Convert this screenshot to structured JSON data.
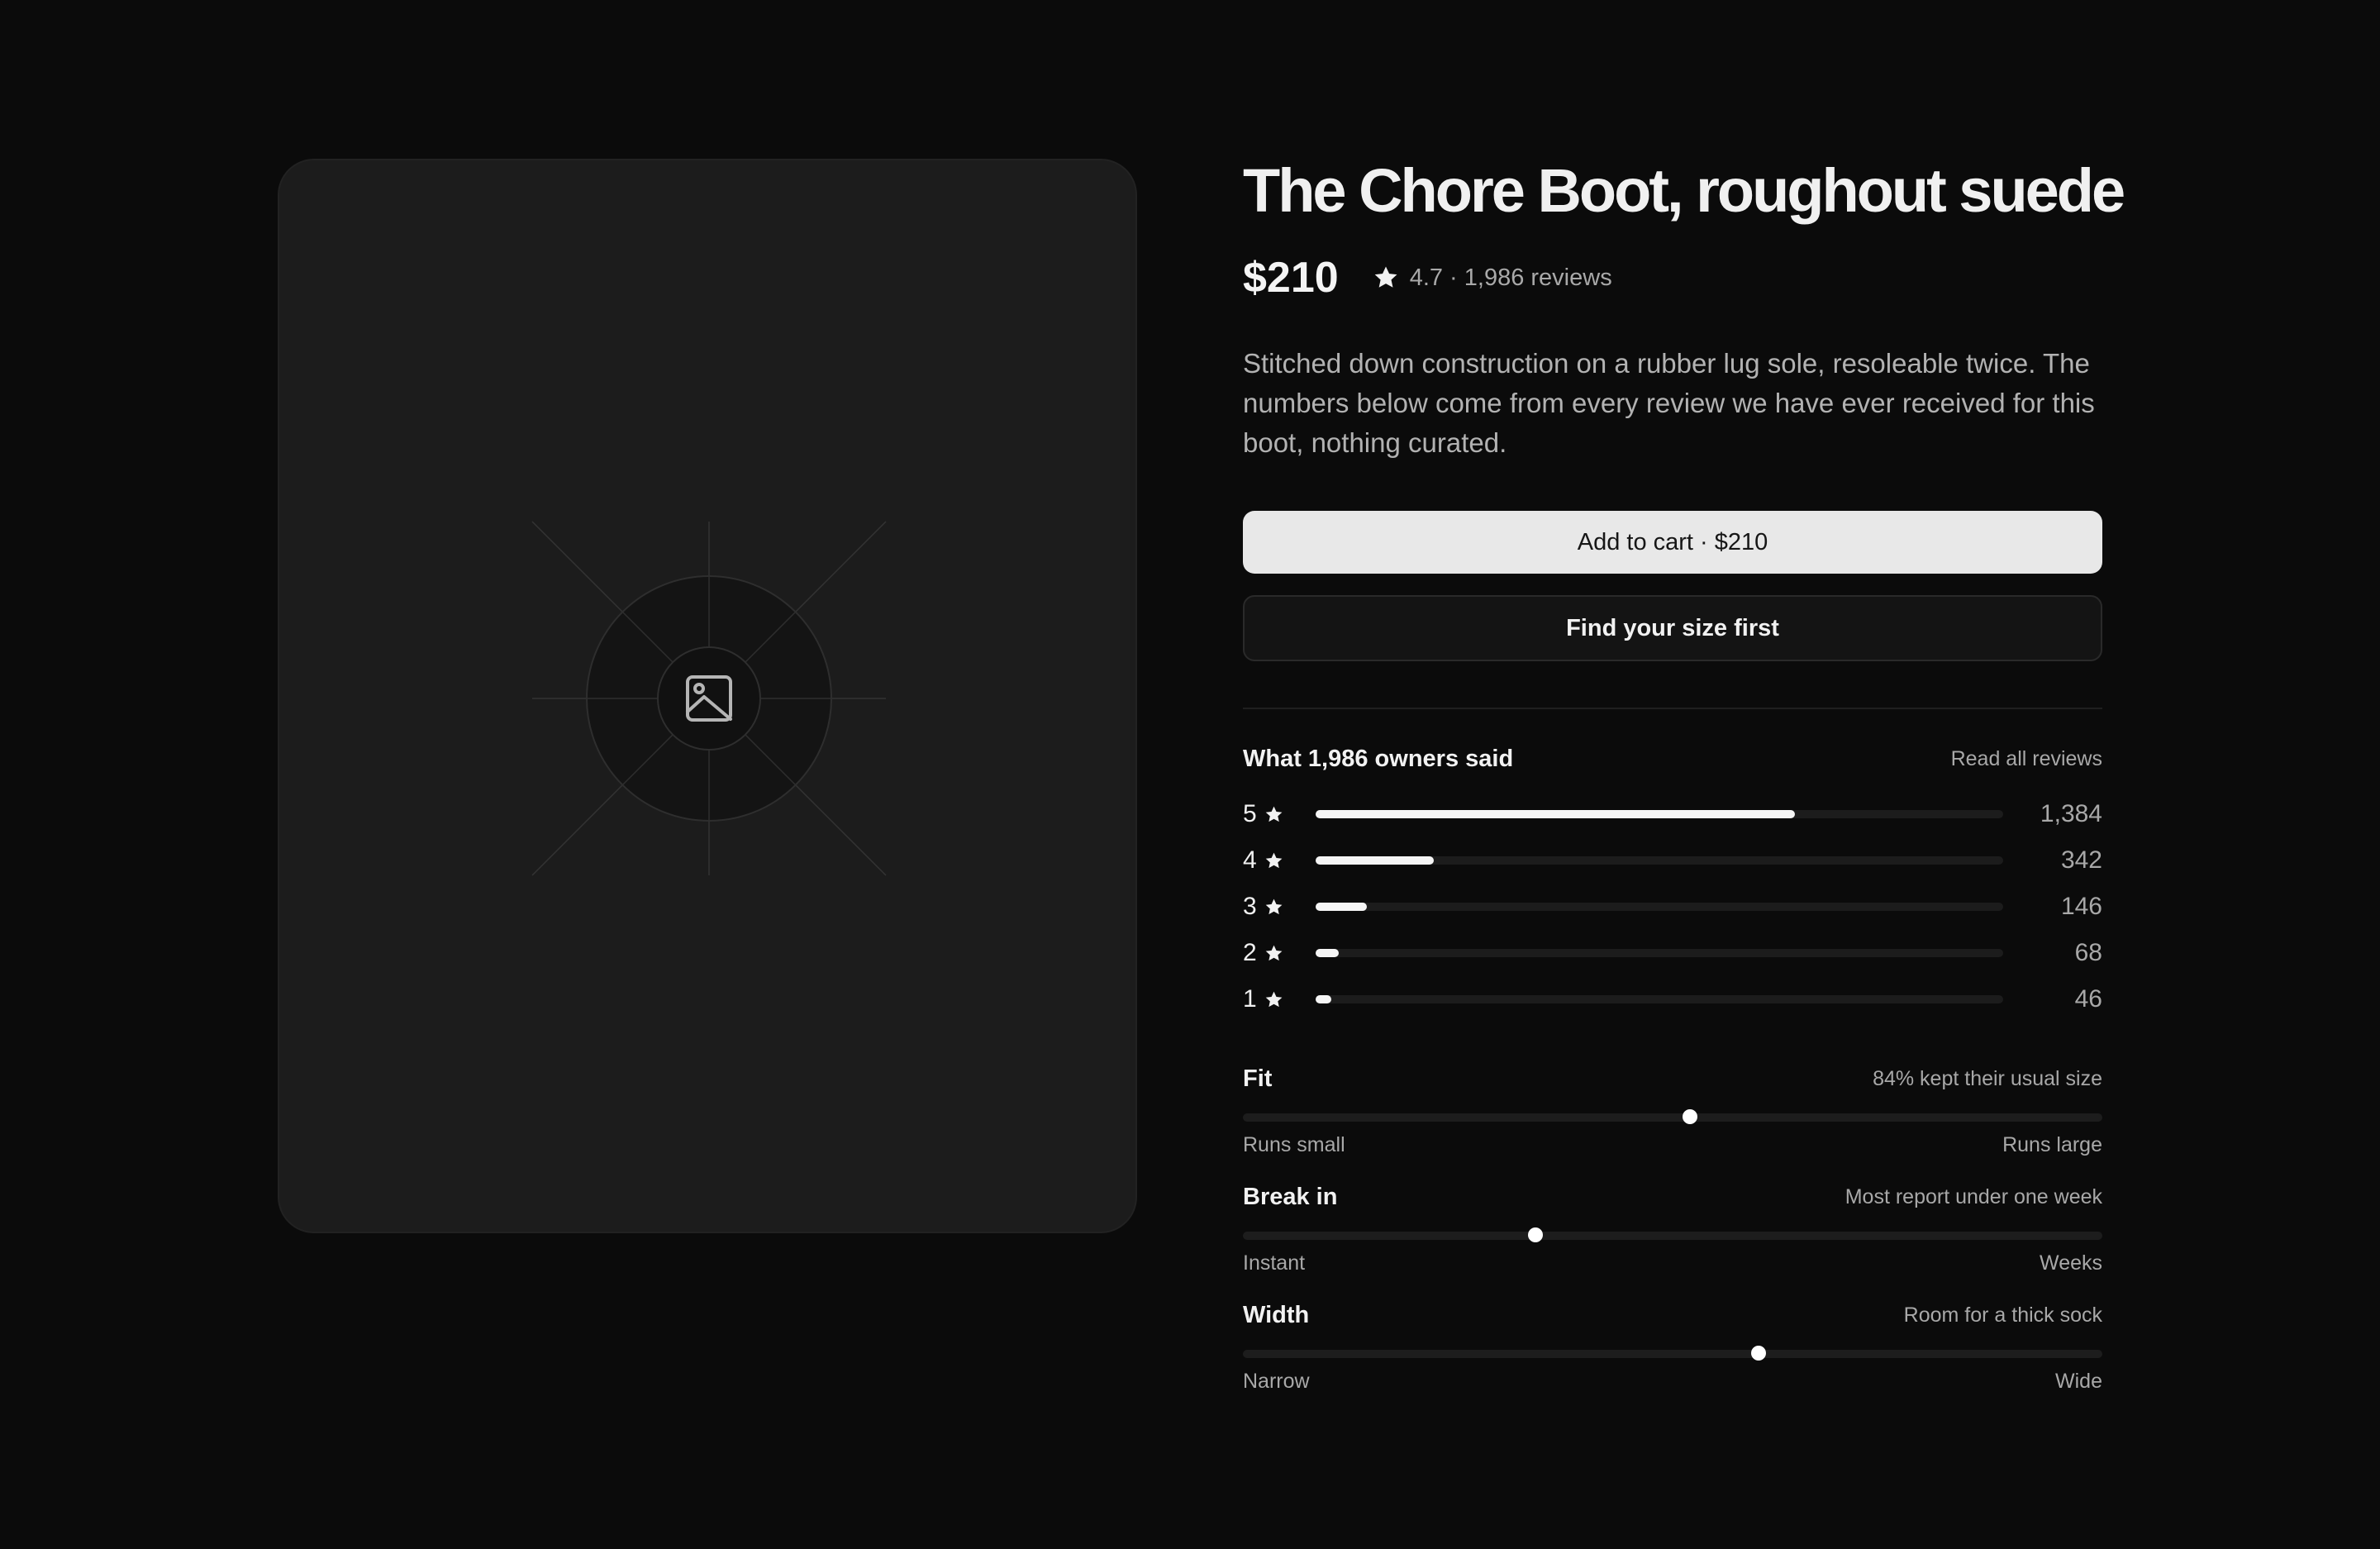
{
  "product": {
    "title": "The Chore Boot, roughout suede",
    "price": "$210",
    "rating_text": "4.7 · 1,986 reviews",
    "description": "Stitched down construction on a rubber lug sole, resoleable twice. The numbers below come from every review we have ever received for this boot, nothing curated.",
    "image_icon": "image-placeholder-icon"
  },
  "actions": {
    "add_to_cart": "Add to cart · $210",
    "find_size": "Find your size first"
  },
  "reviews": {
    "title": "What 1,986 owners said",
    "link": "Read all reviews",
    "histogram": [
      {
        "stars": "5",
        "count": "1,384",
        "fraction": 0.697
      },
      {
        "stars": "4",
        "count": "342",
        "fraction": 0.172
      },
      {
        "stars": "3",
        "count": "146",
        "fraction": 0.074
      },
      {
        "stars": "2",
        "count": "68",
        "fraction": 0.034
      },
      {
        "stars": "1",
        "count": "46",
        "fraction": 0.023
      }
    ]
  },
  "meters": [
    {
      "label": "Fit",
      "note": "84% kept their usual size",
      "left": "Runs small",
      "right": "Runs large",
      "value": 0.52
    },
    {
      "label": "Break in",
      "note": "Most report under one week",
      "left": "Instant",
      "right": "Weeks",
      "value": 0.34
    },
    {
      "label": "Width",
      "note": "Room for a thick sock",
      "left": "Narrow",
      "right": "Wide",
      "value": 0.6
    }
  ],
  "colors": {
    "background": "#0b0b0b",
    "panel": "#1c1c1c",
    "primary_button": "#e8e8e8",
    "accent": "#f5f5f5"
  }
}
